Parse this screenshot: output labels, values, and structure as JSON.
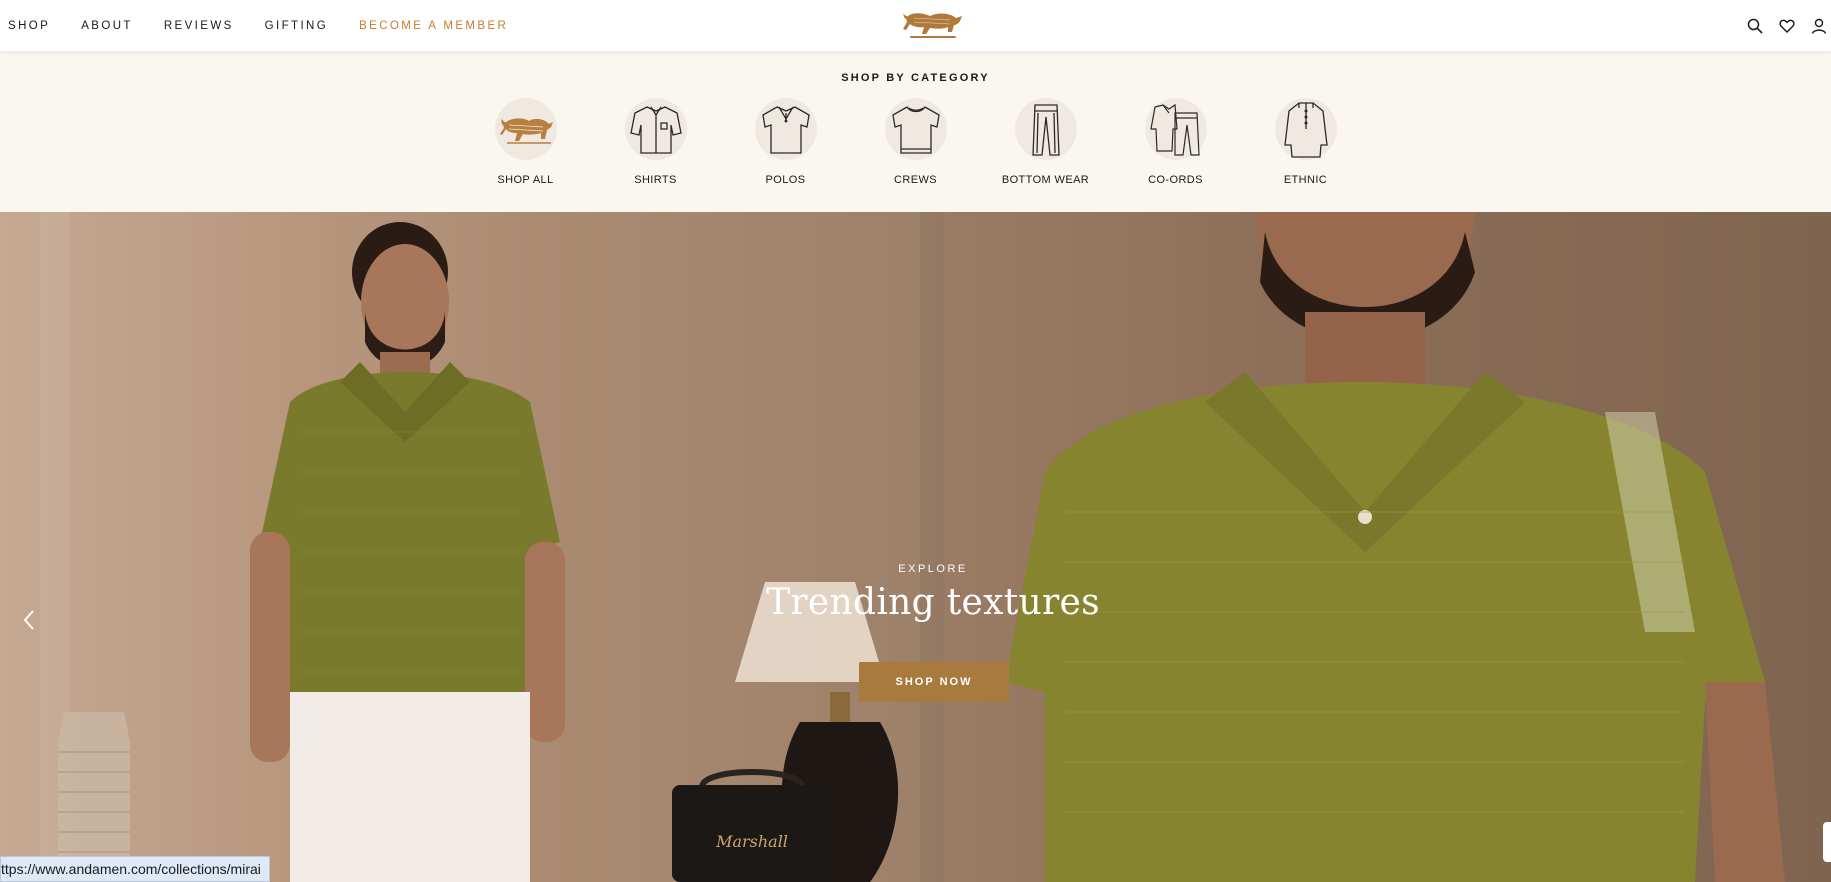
{
  "nav": {
    "items": [
      {
        "label": "SHOP"
      },
      {
        "label": "ABOUT"
      },
      {
        "label": "REVIEWS"
      },
      {
        "label": "GIFTING"
      },
      {
        "label": "BECOME A MEMBER",
        "accent": true
      }
    ],
    "accent_color": "#c97a2d"
  },
  "header": {
    "logo": "bull-logo",
    "icons": [
      "search-icon",
      "heart-icon",
      "user-icon"
    ]
  },
  "categories": {
    "title": "SHOP BY CATEGORY",
    "items": [
      {
        "label": "SHOP ALL",
        "icon": "bull-icon"
      },
      {
        "label": "SHIRTS",
        "icon": "shirt-icon"
      },
      {
        "label": "POLOS",
        "icon": "polo-icon"
      },
      {
        "label": "CREWS",
        "icon": "tshirt-icon"
      },
      {
        "label": "BOTTOM WEAR",
        "icon": "trousers-icon"
      },
      {
        "label": "CO-ORDS",
        "icon": "coord-icon"
      },
      {
        "label": "ETHNIC",
        "icon": "kurta-icon"
      }
    ]
  },
  "hero": {
    "eyebrow": "EXPLORE",
    "title": "Trending textures",
    "cta": "SHOP NOW",
    "cta_color": "#a87a3d",
    "speaker_brand": "Marshall"
  },
  "status_bar": {
    "url": "ttps://www.andamen.com/collections/mirai"
  }
}
